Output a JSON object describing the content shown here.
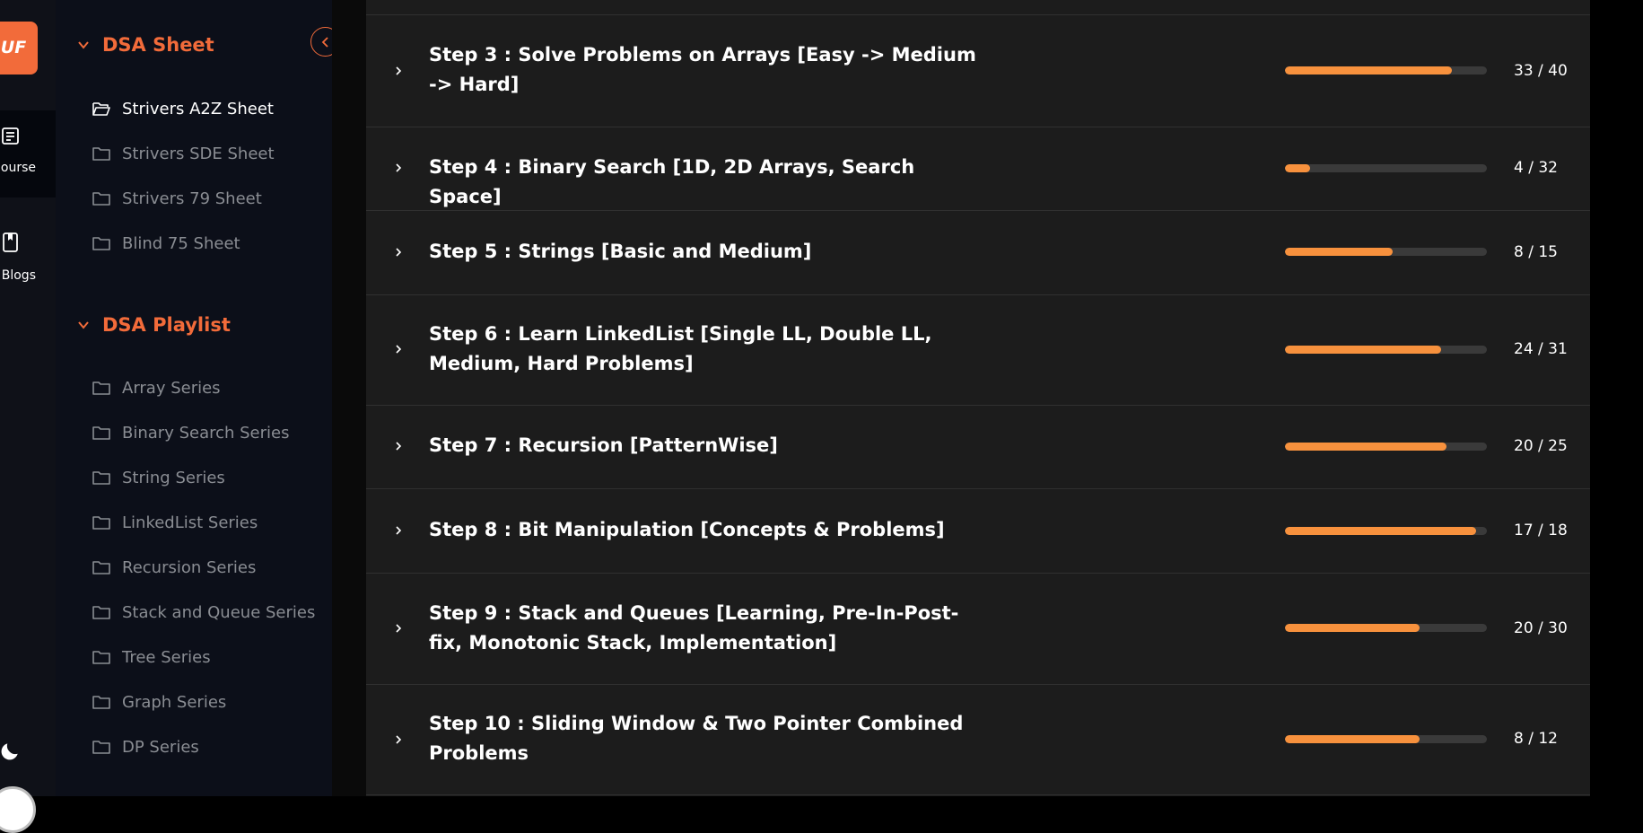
{
  "app": {
    "logo_text": "UF",
    "rail": {
      "items": [
        {
          "label": "ourse",
          "icon": "course-icon"
        },
        {
          "label": "Blogs",
          "icon": "bookmark-icon"
        }
      ],
      "theme_icon": "moon-icon"
    }
  },
  "sidebar": {
    "sections": [
      {
        "title": "DSA Sheet",
        "items": [
          {
            "label": "Strivers A2Z Sheet",
            "active": true
          },
          {
            "label": "Strivers SDE Sheet"
          },
          {
            "label": "Strivers 79 Sheet"
          },
          {
            "label": "Blind 75 Sheet"
          }
        ]
      },
      {
        "title": "DSA Playlist",
        "items": [
          {
            "label": "Array Series"
          },
          {
            "label": "Binary Search Series"
          },
          {
            "label": "String Series"
          },
          {
            "label": "LinkedList Series"
          },
          {
            "label": "Recursion Series"
          },
          {
            "label": "Stack and Queue Series"
          },
          {
            "label": "Tree Series"
          },
          {
            "label": "Graph Series"
          },
          {
            "label": "DP Series"
          }
        ]
      }
    ]
  },
  "steps": [
    {
      "title": "Step 3 : Solve Problems on Arrays [Easy -> Medium -> Hard]",
      "done": 33,
      "total": 40,
      "count": "33 / 40"
    },
    {
      "title": "Step 4 : Binary Search [1D, 2D Arrays, Search Space]",
      "done": 4,
      "total": 32,
      "count": "4 / 32"
    },
    {
      "title": "Step 5 : Strings [Basic and Medium]",
      "done": 8,
      "total": 15,
      "count": "8 / 15"
    },
    {
      "title": "Step 6 : Learn LinkedList [Single LL, Double LL, Medium, Hard Problems]",
      "done": 24,
      "total": 31,
      "count": "24 / 31"
    },
    {
      "title": "Step 7 : Recursion [PatternWise]",
      "done": 20,
      "total": 25,
      "count": "20 / 25"
    },
    {
      "title": "Step 8 : Bit Manipulation [Concepts & Problems]",
      "done": 17,
      "total": 18,
      "count": "17 / 18"
    },
    {
      "title": "Step 9 : Stack and Queues [Learning, Pre-In-Post-fix, Monotonic Stack, Implementation]",
      "done": 20,
      "total": 30,
      "count": "20 / 30"
    },
    {
      "title": "Step 10 : Sliding Window & Two Pointer Combined Problems",
      "done": 8,
      "total": 12,
      "count": "8 / 12"
    }
  ],
  "colors": {
    "accent": "#f26b3a",
    "progress": "#f7913d",
    "track": "#3a3a3a"
  }
}
